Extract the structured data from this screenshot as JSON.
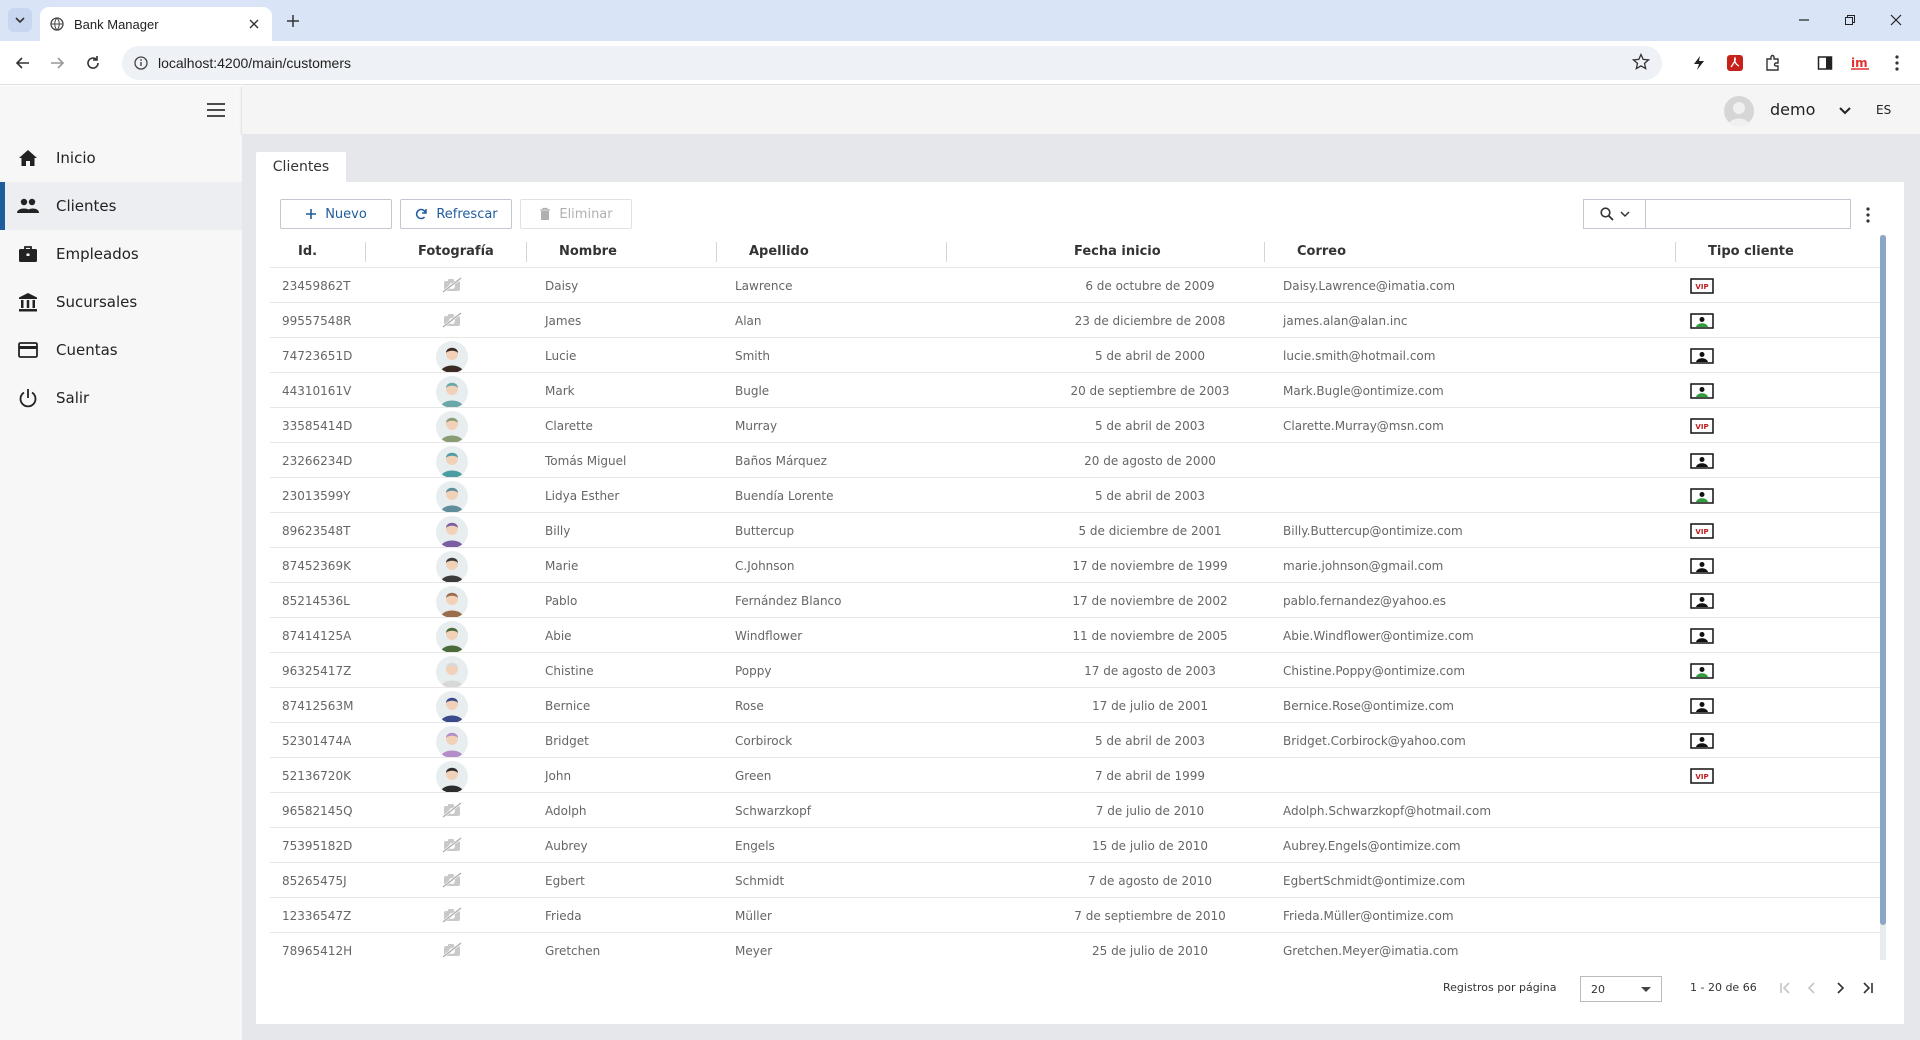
{
  "browser": {
    "tab_title": "Bank Manager",
    "url": "localhost:4200/main/customers"
  },
  "sidebar": {
    "items": [
      {
        "label": "Inicio",
        "icon": "home-icon"
      },
      {
        "label": "Clientes",
        "icon": "people-icon"
      },
      {
        "label": "Empleados",
        "icon": "briefcase-icon"
      },
      {
        "label": "Sucursales",
        "icon": "bank-icon"
      },
      {
        "label": "Cuentas",
        "icon": "credit-card-icon"
      },
      {
        "label": "Salir",
        "icon": "power-icon"
      }
    ],
    "active_index": 1
  },
  "header": {
    "user": "demo",
    "lang": "ES"
  },
  "page": {
    "tab_label": "Clientes"
  },
  "toolbar": {
    "new_label": "Nuevo",
    "refresh_label": "Refrescar",
    "delete_label": "Eliminar",
    "search_value": ""
  },
  "table": {
    "columns": [
      "Id.",
      "Fotografía",
      "Nombre",
      "Apellido",
      "Fecha inicio",
      "Correo",
      "Tipo cliente"
    ],
    "rows": [
      {
        "id": "23459862T",
        "photo": "none-grey",
        "nombre": "Daisy",
        "apellido": "Lawrence",
        "fecha": "6 de octubre de 2009",
        "correo": "Daisy.Lawrence@imatia.com",
        "tipo": "vip"
      },
      {
        "id": "99557548R",
        "photo": "none-grey",
        "nombre": "James",
        "apellido": "Alan",
        "fecha": "23 de diciembre de 2008",
        "correo": "james.alan@alan.inc",
        "tipo": "green"
      },
      {
        "id": "74723651D",
        "photo": "avatar",
        "nombre": "Lucie",
        "apellido": "Smith",
        "fecha": "5 de abril de 2000",
        "correo": "lucie.smith@hotmail.com",
        "tipo": "blue"
      },
      {
        "id": "44310161V",
        "photo": "avatar",
        "nombre": "Mark",
        "apellido": "Bugle",
        "fecha": "20 de septiembre de 2003",
        "correo": "Mark.Bugle@ontimize.com",
        "tipo": "green"
      },
      {
        "id": "33585414D",
        "photo": "avatar",
        "nombre": "Clarette",
        "apellido": "Murray",
        "fecha": "5 de abril de 2003",
        "correo": "Clarette.Murray@msn.com",
        "tipo": "vip"
      },
      {
        "id": "23266234D",
        "photo": "avatar",
        "nombre": "Tomás Miguel",
        "apellido": "Baños Márquez",
        "fecha": "20 de agosto de 2000",
        "correo": "",
        "tipo": "blue"
      },
      {
        "id": "23013599Y",
        "photo": "avatar",
        "nombre": "Lidya Esther",
        "apellido": "Buendía Lorente",
        "fecha": "5 de abril de 2003",
        "correo": "",
        "tipo": "green"
      },
      {
        "id": "89623548T",
        "photo": "avatar",
        "nombre": "Billy",
        "apellido": "Buttercup",
        "fecha": "5 de diciembre de 2001",
        "correo": "Billy.Buttercup@ontimize.com",
        "tipo": "vip"
      },
      {
        "id": "87452369K",
        "photo": "avatar",
        "nombre": "Marie",
        "apellido": "C.Johnson",
        "fecha": "17 de noviembre de 1999",
        "correo": "marie.johnson@gmail.com",
        "tipo": "blue"
      },
      {
        "id": "85214536L",
        "photo": "avatar",
        "nombre": "Pablo",
        "apellido": "Fernández Blanco",
        "fecha": "17 de noviembre de 2002",
        "correo": "pablo.fernandez@yahoo.es",
        "tipo": "blue"
      },
      {
        "id": "87414125A",
        "photo": "avatar",
        "nombre": "Abie",
        "apellido": "Windflower",
        "fecha": "11 de noviembre de 2005",
        "correo": "Abie.Windflower@ontimize.com",
        "tipo": "blue"
      },
      {
        "id": "96325417Z",
        "photo": "avatar",
        "nombre": "Chistine",
        "apellido": "Poppy",
        "fecha": "17 de agosto de 2003",
        "correo": "Chistine.Poppy@ontimize.com",
        "tipo": "green"
      },
      {
        "id": "87412563M",
        "photo": "avatar",
        "nombre": "Bernice",
        "apellido": "Rose",
        "fecha": "17 de julio de 2001",
        "correo": "Bernice.Rose@ontimize.com",
        "tipo": "blue"
      },
      {
        "id": "52301474A",
        "photo": "avatar",
        "nombre": "Bridget",
        "apellido": "Corbirock",
        "fecha": "5 de abril de 2003",
        "correo": "Bridget.Corbirock@yahoo.com",
        "tipo": "blue"
      },
      {
        "id": "52136720K",
        "photo": "avatar",
        "nombre": "John",
        "apellido": "Green",
        "fecha": "7 de abril de 1999",
        "correo": "",
        "tipo": "vip"
      },
      {
        "id": "96582145Q",
        "photo": "none-grey",
        "nombre": "Adolph",
        "apellido": "Schwarzkopf",
        "fecha": "7 de julio de 2010",
        "correo": "Adolph.Schwarzkopf@hotmail.com",
        "tipo": ""
      },
      {
        "id": "75395182D",
        "photo": "none-grey",
        "nombre": "Aubrey",
        "apellido": "Engels",
        "fecha": "15 de julio de 2010",
        "correo": "Aubrey.Engels@ontimize.com",
        "tipo": ""
      },
      {
        "id": "85265475J",
        "photo": "none-grey",
        "nombre": "Egbert",
        "apellido": "Schmidt",
        "fecha": "7 de agosto de 2010",
        "correo": "EgbertSchmidt@ontimize.com",
        "tipo": ""
      },
      {
        "id": "12336547Z",
        "photo": "none-grey",
        "nombre": "Frieda",
        "apellido": "Müller",
        "fecha": "7 de septiembre de 2010",
        "correo": "Frieda.Müller@ontimize.com",
        "tipo": ""
      },
      {
        "id": "78965412H",
        "photo": "none-grey",
        "nombre": "Gretchen",
        "apellido": "Meyer",
        "fecha": "25 de julio de 2010",
        "correo": "Gretchen.Meyer@imatia.com",
        "tipo": ""
      }
    ]
  },
  "pager": {
    "label": "Registros por página",
    "page_size": "20",
    "range": "1 - 20 de 66"
  },
  "colors": {
    "accent": "#1f5c9e",
    "sidebar_bg": "#f7f7f7",
    "content_bg": "#e6e7ea"
  }
}
